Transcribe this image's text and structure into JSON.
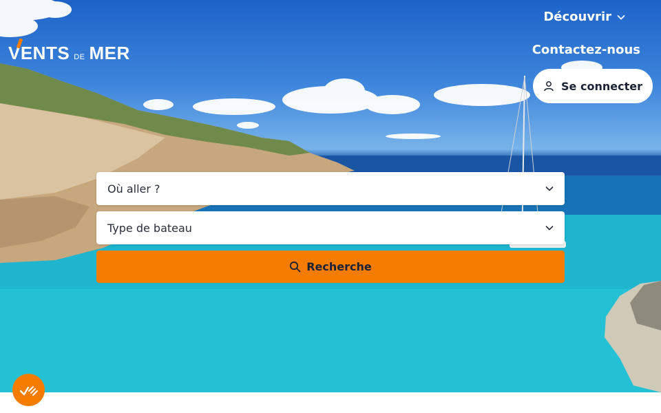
{
  "brand": {
    "logo_main": "VENTS",
    "logo_small": "DE",
    "logo_end": "MER",
    "accent_color": "#f47c00"
  },
  "nav": {
    "discover_label": "Découvrir",
    "contact_label": "Contactez-nous",
    "login_label": "Se connecter"
  },
  "search": {
    "destination_placeholder": "Où aller ?",
    "boat_type_placeholder": "Type de bateau",
    "submit_label": "Recherche"
  },
  "icons": {
    "discover_chevron": "chevron-down-icon",
    "user": "user-icon",
    "select_chevron": "chevron-down-icon",
    "search": "search-icon",
    "fab": "check-list-icon"
  }
}
